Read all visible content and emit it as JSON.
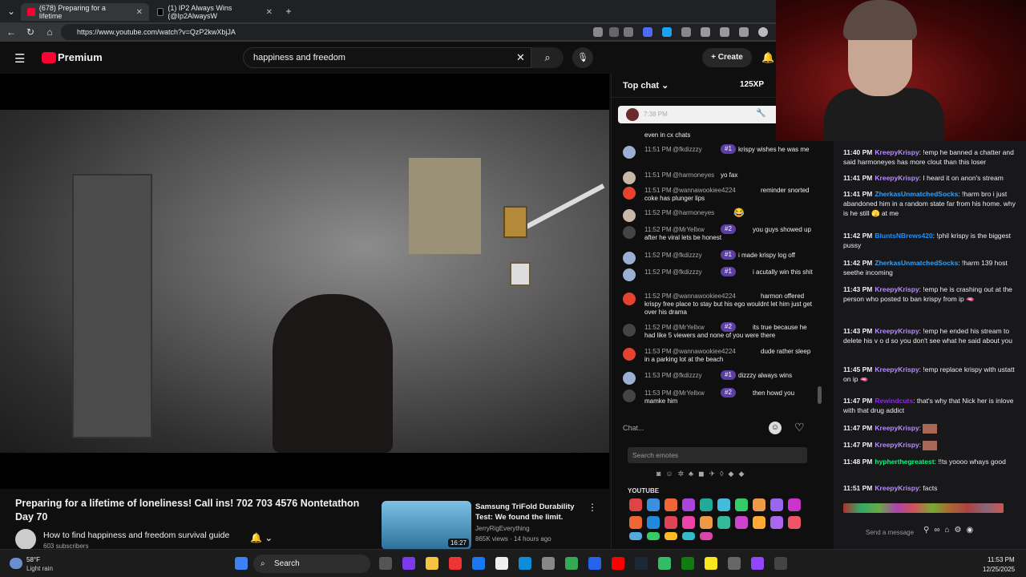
{
  "browser": {
    "tabs": [
      {
        "label": "(678) Preparing for a lifetime"
      },
      {
        "label": "(1) IP2 Always Wins (@Ip2AlwaysW"
      }
    ],
    "url": "https://www.youtube.com/watch?v=QzP2kwXbjJA"
  },
  "youtube": {
    "brand": "Premium",
    "search_value": "happiness and freedom",
    "create_label": "Create",
    "video": {
      "title": "Preparing for a lifetime of loneliness! Call ins! 702 703 4576 Nontetathon Day 70",
      "channel": "How to find happiness and freedom survival guide",
      "subscribers": "603 subscribers"
    },
    "recommended": {
      "title": "Samsung TriFold Durability Test: We found the limit.",
      "channel": "JerryRigEverything",
      "meta": "865K views · 14 hours ago",
      "duration": "16:27"
    }
  },
  "ytchat": {
    "header": "Top chat",
    "xp": "125XP",
    "pinned_time": "7:38 PM",
    "messages": [
      {
        "time": "",
        "name": "",
        "badge": "",
        "text": "even in cx chats"
      },
      {
        "time": "11:51 PM",
        "name": "@fkdizzzy",
        "badge": "#1",
        "text": "krispy wishes he was me"
      },
      {
        "time": "11:51 PM",
        "name": "@harmoneyes",
        "badge": "",
        "text": "yo fax"
      },
      {
        "time": "11:51 PM",
        "name": "@wannawookiee4224",
        "badge": "",
        "text": "reminder snorted coke has plunger lips"
      },
      {
        "time": "11:52 PM",
        "name": "@harmoneyes",
        "badge": "",
        "text": "😂"
      },
      {
        "time": "11:52 PM",
        "name": "@MrYellxw",
        "badge": "#2",
        "text": "you guys showed up after he viral lets be honest"
      },
      {
        "time": "11:52 PM",
        "name": "@fkdizzzy",
        "badge": "#1",
        "text": "i made krispy log off"
      },
      {
        "time": "11:52 PM",
        "name": "@fkdizzzy",
        "badge": "#1",
        "text": "i acutally win this shit"
      },
      {
        "time": "11:52 PM",
        "name": "@wannawookiee4224",
        "badge": "",
        "text": "harmon offered krispy free place to stay but his ego wouldnt let him just get over his drama"
      },
      {
        "time": "11:52 PM",
        "name": "@MrYellxw",
        "badge": "#2",
        "text": "its true because he had like 5 viewers and none of you were there"
      },
      {
        "time": "11:53 PM",
        "name": "@wannawookiee4224",
        "badge": "",
        "text": "dude rather sleep in a parking lot at the beach"
      },
      {
        "time": "11:53 PM",
        "name": "@fkdizzzy",
        "badge": "#1",
        "text": "dizzzy always wins"
      },
      {
        "time": "11:53 PM",
        "name": "@MrYellxw",
        "badge": "#2",
        "text": "then howd you mamke him"
      }
    ],
    "input_placeholder": "Chat...",
    "emote_search_placeholder": "Search emotes",
    "emote_section": "YOUTUBE"
  },
  "twitch": {
    "messages": [
      {
        "time": "11:40 PM",
        "user": "KreepyKrispy",
        "text": ": !emp he banned a chatter and said harmoneyes has more clout than this loser"
      },
      {
        "time": "11:41 PM",
        "user": "KreepyKrispy",
        "text": ": I heard it on anon's stream"
      },
      {
        "time": "11:41 PM",
        "user": "ZherkasUnmatchedSocks",
        "text": ": !harm bro i just abandoned him in a random state far from his home. why is he still 🫣 at me"
      },
      {
        "time": "11:42 PM",
        "user": "BluntsNBrews420",
        "text": ": !phil krispy is the biggest pussy"
      },
      {
        "time": "11:42 PM",
        "user": "ZherkasUnmatchedSocks",
        "text": ": !harm 139 host seethe incoming"
      },
      {
        "time": "11:43 PM",
        "user": "KreepyKrispy",
        "text": ": !emp he is crashing out at the person who posted to ban krispy from ip 🫦"
      },
      {
        "time": "11:43 PM",
        "user": "KreepyKrispy",
        "text": ": !emp he ended his stream to delete his v o d so you don't see what he said about you"
      },
      {
        "time": "11:45 PM",
        "user": "KreepyKrispy",
        "text": ": !emp replace krispy with ustatt on ip 🫦"
      },
      {
        "time": "11:47 PM",
        "user": "Rewindcuts",
        "text": ": that's why that Nick her is inlove with that drug addict"
      },
      {
        "time": "11:47 PM",
        "user": "KreepyKrispy",
        "text": ":"
      },
      {
        "time": "11:47 PM",
        "user": "KreepyKrispy",
        "text": ":"
      },
      {
        "time": "11:48 PM",
        "user": "hypherthegreatest",
        "text": ": !!ts yoooo whays good"
      },
      {
        "time": "11:51 PM",
        "user": "KreepyKrispy",
        "text": ": facts"
      }
    ],
    "input_placeholder": "Send a message"
  },
  "taskbar": {
    "temp": "58°F",
    "condition": "Light rain",
    "search": "Search",
    "time": "11:53 PM",
    "date": "12/25/2025"
  }
}
